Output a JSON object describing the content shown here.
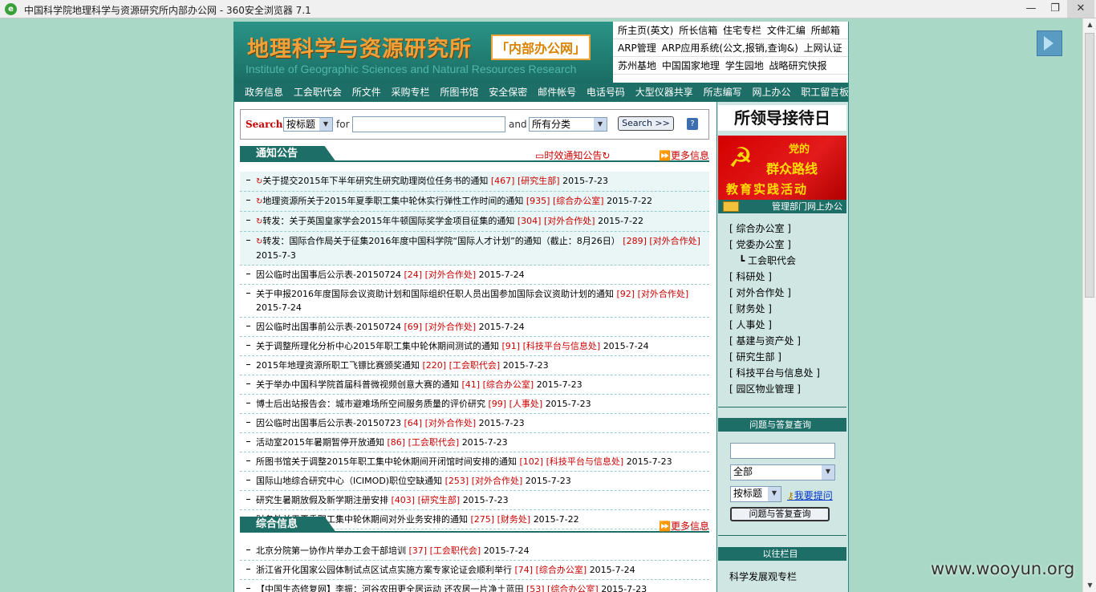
{
  "window": {
    "title": "中国科学院地理科学与资源研究所内部办公网 - 360安全浏览器 7.1",
    "min": "—",
    "restore": "❐",
    "close": "✕"
  },
  "header": {
    "logo_cn": "地理科学与资源研究所",
    "logo_badge": "「内部办公网」",
    "logo_en": "Institute of Geographic Sciences and Natural Resources Research",
    "top_links": [
      [
        "所主页(英文)",
        "所长信箱",
        "住宅专栏",
        "文件汇编",
        "所邮箱"
      ],
      [
        "ARP管理",
        "ARP应用系统(公文,报销,查询&)",
        "上网认证"
      ],
      [
        "苏州基地",
        "中国国家地理",
        "学生园地",
        "战略研究快报"
      ]
    ]
  },
  "nav": [
    "政务信息",
    "工会职代会",
    "所文件",
    "采购专栏",
    "所图书馆",
    "安全保密",
    "邮件帐号",
    "电话号码",
    "大型仪器共享",
    "所志编写",
    "网上办公",
    "职工留言板"
  ],
  "search": {
    "label": "Search",
    "by_value": "按标题",
    "for_label": "for",
    "and_label": "and",
    "category_value": "所有分类",
    "button": "Search >>",
    "help": "?"
  },
  "notice": {
    "title": "通知公告",
    "mid_link": "时效通知公告",
    "more": "更多信息",
    "items": [
      {
        "hot": "↻",
        "text": "关于提交2015年下半年研究生研究助理岗位任务书的通知",
        "num": "[467]",
        "dept": "[研究生部]",
        "date": "2015-7-23"
      },
      {
        "hot": "↻",
        "text": "地理资源所关于2015年夏季职工集中轮休实行弹性工作时间的通知",
        "num": "[935]",
        "dept": "[综合办公室]",
        "date": "2015-7-22"
      },
      {
        "hot": "↻",
        "text": "转发：关于英国皇家学会2015年牛顿国际奖学金项目征集的通知",
        "num": "[304]",
        "dept": "[对外合作处]",
        "date": "2015-7-22"
      },
      {
        "hot": "↻",
        "text": "转发：国际合作局关于征集2016年度中国科学院“国际人才计划”的通知（截止：8月26日）",
        "num": "[289]",
        "dept": "[对外合作处]",
        "date": "2015-7-3"
      },
      {
        "hot": "",
        "text": "因公临时出国事后公示表-20150724",
        "num": "[24]",
        "dept": "[对外合作处]",
        "date": "2015-7-24"
      },
      {
        "hot": "",
        "text": "关于申报2016年度国际会议资助计划和国际组织任职人员出国参加国际会议资助计划的通知",
        "num": "[92]",
        "dept": "[对外合作处]",
        "date": "2015-7-24"
      },
      {
        "hot": "",
        "text": "因公临时出国事前公示表-20150724",
        "num": "[69]",
        "dept": "[对外合作处]",
        "date": "2015-7-24"
      },
      {
        "hot": "",
        "text": "关于调整所理化分析中心2015年职工集中轮休期间测试的通知",
        "num": "[91]",
        "dept": "[科技平台与信息处]",
        "date": "2015-7-24"
      },
      {
        "hot": "",
        "text": "2015年地理资源所职工飞镖比赛颁奖通知",
        "num": "[220]",
        "dept": "[工会职代会]",
        "date": "2015-7-23"
      },
      {
        "hot": "",
        "text": "关于举办中国科学院首届科普微视频创意大赛的通知",
        "num": "[41]",
        "dept": "[综合办公室]",
        "date": "2015-7-23"
      },
      {
        "hot": "",
        "text": "博士后出站报告会：城市避难场所空间服务质量的评价研究",
        "num": "[99]",
        "dept": "[人事处]",
        "date": "2015-7-23"
      },
      {
        "hot": "",
        "text": "因公临时出国事后公示表-20150723",
        "num": "[64]",
        "dept": "[对外合作处]",
        "date": "2015-7-23"
      },
      {
        "hot": "",
        "text": "活动室2015年暑期暂停开放通知",
        "num": "[86]",
        "dept": "[工会职代会]",
        "date": "2015-7-23"
      },
      {
        "hot": "",
        "text": "所图书馆关于调整2015年职工集中轮休期间开闭馆时间安排的通知",
        "num": "[102]",
        "dept": "[科技平台与信息处]",
        "date": "2015-7-23"
      },
      {
        "hot": "",
        "text": "国际山地综合研究中心（ICIMOD)职位空缺通知",
        "num": "[253]",
        "dept": "[对外合作处]",
        "date": "2015-7-23"
      },
      {
        "hot": "",
        "text": "研究生暑期放假及新学期注册安排",
        "num": "[403]",
        "dept": "[研究生部]",
        "date": "2015-7-23"
      },
      {
        "hot": "",
        "text": "财务处关于夏季职工集中轮休期间对外业务安排的通知",
        "num": "[275]",
        "dept": "[财务处]",
        "date": "2015-7-22"
      }
    ]
  },
  "general": {
    "title": "综合信息",
    "more": "更多信息",
    "items": [
      {
        "text": "北京分院第一协作片举办工会干部培训",
        "num": "[37]",
        "dept": "[工会职代会]",
        "date": "2015-7-24"
      },
      {
        "text": "浙江省开化国家公园体制试点区试点实施方案专家论证会顺利举行",
        "num": "[74]",
        "dept": "[综合办公室]",
        "date": "2015-7-24"
      },
      {
        "text": "【中国生态修复网】李振：河谷农田更全居运动 还农居一片净土蓝田",
        "num": "[53]",
        "dept": "[综合办公室]",
        "date": "2015-7-23"
      }
    ]
  },
  "right": {
    "reception_title": "所领导接待日",
    "party_l1": "党的",
    "party_l2": "群众路线",
    "party_l3": "教育实践活动",
    "office_bar": "管理部门网上办公",
    "depts": [
      "[ 综合办公室 ]",
      "[ 党委办公室 ]",
      "┗ 工会职代会",
      "[ 科研处 ]",
      "[ 对外合作处 ]",
      "[ 财务处 ]",
      "[ 人事处 ]",
      "[ 基建与资产处 ]",
      "[ 研究生部 ]",
      "[ 科技平台与信息处 ]",
      "[ 园区物业管理 ]"
    ],
    "qa_bar": "问题与答复查询",
    "qa_scope": "全部",
    "qa_by": "按标题",
    "qa_ask": "我要提问",
    "qa_button": "问题与答复查询",
    "past_bar": "以往栏目",
    "past_item": "科学发展观专栏"
  },
  "watermark": "www.wooyun.org"
}
